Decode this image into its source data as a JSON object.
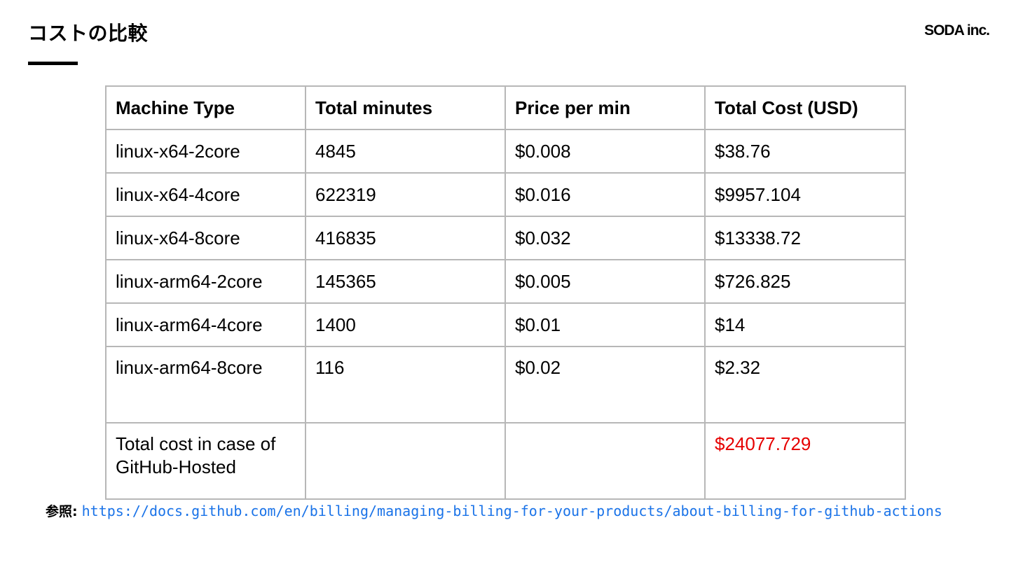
{
  "slide": {
    "title": "コストの比較",
    "brand": "SODA inc."
  },
  "table": {
    "headers": [
      "Machine Type",
      "Total minutes",
      "Price per min",
      "Total Cost (USD)"
    ],
    "rows": [
      [
        "linux-x64-2core",
        "4845",
        "$0.008",
        "$38.76"
      ],
      [
        "linux-x64-4core",
        "622319",
        "$0.016",
        "$9957.104"
      ],
      [
        "linux-x64-8core",
        "416835",
        "$0.032",
        "$13338.72"
      ],
      [
        "linux-arm64-2core",
        "145365",
        "$0.005",
        "$726.825"
      ],
      [
        "linux-arm64-4core",
        "1400",
        "$0.01",
        "$14"
      ],
      [
        "linux-arm64-8core",
        "116",
        "$0.02",
        "$2.32"
      ]
    ],
    "total_row": {
      "label_line1": "Total cost in case of",
      "label_line2": "GitHub-Hosted",
      "minutes": "",
      "price": "",
      "cost": "$24077.729"
    }
  },
  "reference": {
    "label": "参照:",
    "url": "https://docs.github.com/en/billing/managing-billing-for-your-products/about-billing-for-github-actions"
  },
  "colors": {
    "highlight": "#e60000",
    "link": "#1a73e8",
    "border": "#b7b7b7"
  }
}
